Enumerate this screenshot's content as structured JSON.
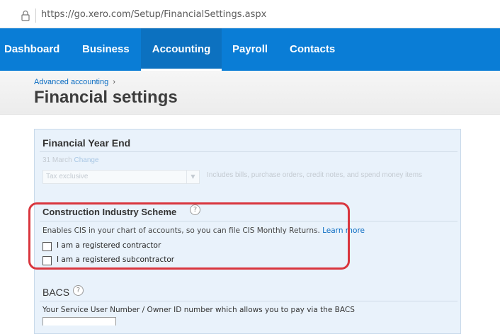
{
  "browser": {
    "url": "https://go.xero.com/Setup/FinancialSettings.aspx",
    "lock_icon": "lock-icon"
  },
  "nav": {
    "tabs": [
      {
        "label": "Dashboard",
        "active": false
      },
      {
        "label": "Business",
        "active": false
      },
      {
        "label": "Accounting",
        "active": true
      },
      {
        "label": "Payroll",
        "active": false
      },
      {
        "label": "Contacts",
        "active": false
      }
    ],
    "bg_color": "#0a7dd6"
  },
  "header": {
    "breadcrumb": "Advanced accounting",
    "breadcrumb_chevron": "›",
    "title": "Financial settings"
  },
  "financial_year_end": {
    "title": "Financial Year End",
    "date_text": "31 March",
    "change_link": "Change",
    "tax_select_value": "Tax exclusive",
    "tax_note": "Includes bills, purchase orders, credit notes, and spend money items"
  },
  "cis": {
    "title": "Construction Industry Scheme",
    "description": "Enables CIS in your chart of accounts, so you can file CIS Monthly Returns.",
    "learn_more": "Learn more",
    "options": [
      {
        "label": "I am a registered contractor",
        "checked": false
      },
      {
        "label": "I am a registered subcontractor",
        "checked": false
      }
    ],
    "highlight_color": "#d9363e"
  },
  "bacs": {
    "title": "BACS",
    "description": "Your Service User Number / Owner ID number which allows you to pay via the BACS",
    "input_value": ""
  },
  "help_glyph": "?"
}
